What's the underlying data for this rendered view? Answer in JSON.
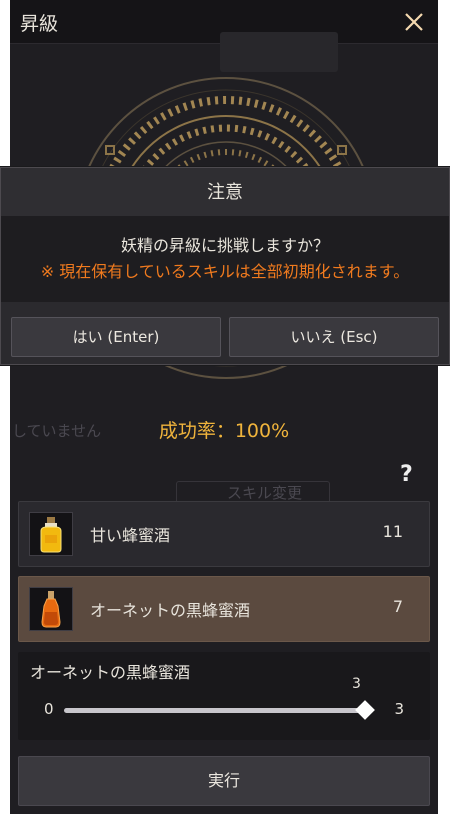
{
  "window": {
    "title": "昇級",
    "close_icon": "close-icon"
  },
  "success_rate": "成功率：100%",
  "help_label": "?",
  "background_ghost": {
    "left_text": "していません",
    "skill_text": "スキル変更"
  },
  "items": [
    {
      "name": "甘い蜂蜜酒",
      "count": "11",
      "icon": "honey-wine-bottle-icon",
      "selected": false
    },
    {
      "name": "オーネットの黒蜂蜜酒",
      "count": "7",
      "icon": "black-honey-wine-bottle-icon",
      "selected": true
    }
  ],
  "quantity": {
    "title": "オーネットの黒蜂蜜酒",
    "min": "0",
    "max": "3",
    "current": "3",
    "level": 1.0
  },
  "execute_label": "実行",
  "dialog": {
    "title": "注意",
    "message": "妖精の昇級に挑戦しますか？",
    "warning": "※ 現在保有しているスキルは全部初期化されます。",
    "yes_label": "はい (Enter)",
    "no_label": "いいえ (Esc)"
  },
  "colors": {
    "accent": "#f0b43c",
    "warning": "#f07a1e",
    "selected_row": "#5b4a3f",
    "panel_bg": "#1f1e22"
  }
}
